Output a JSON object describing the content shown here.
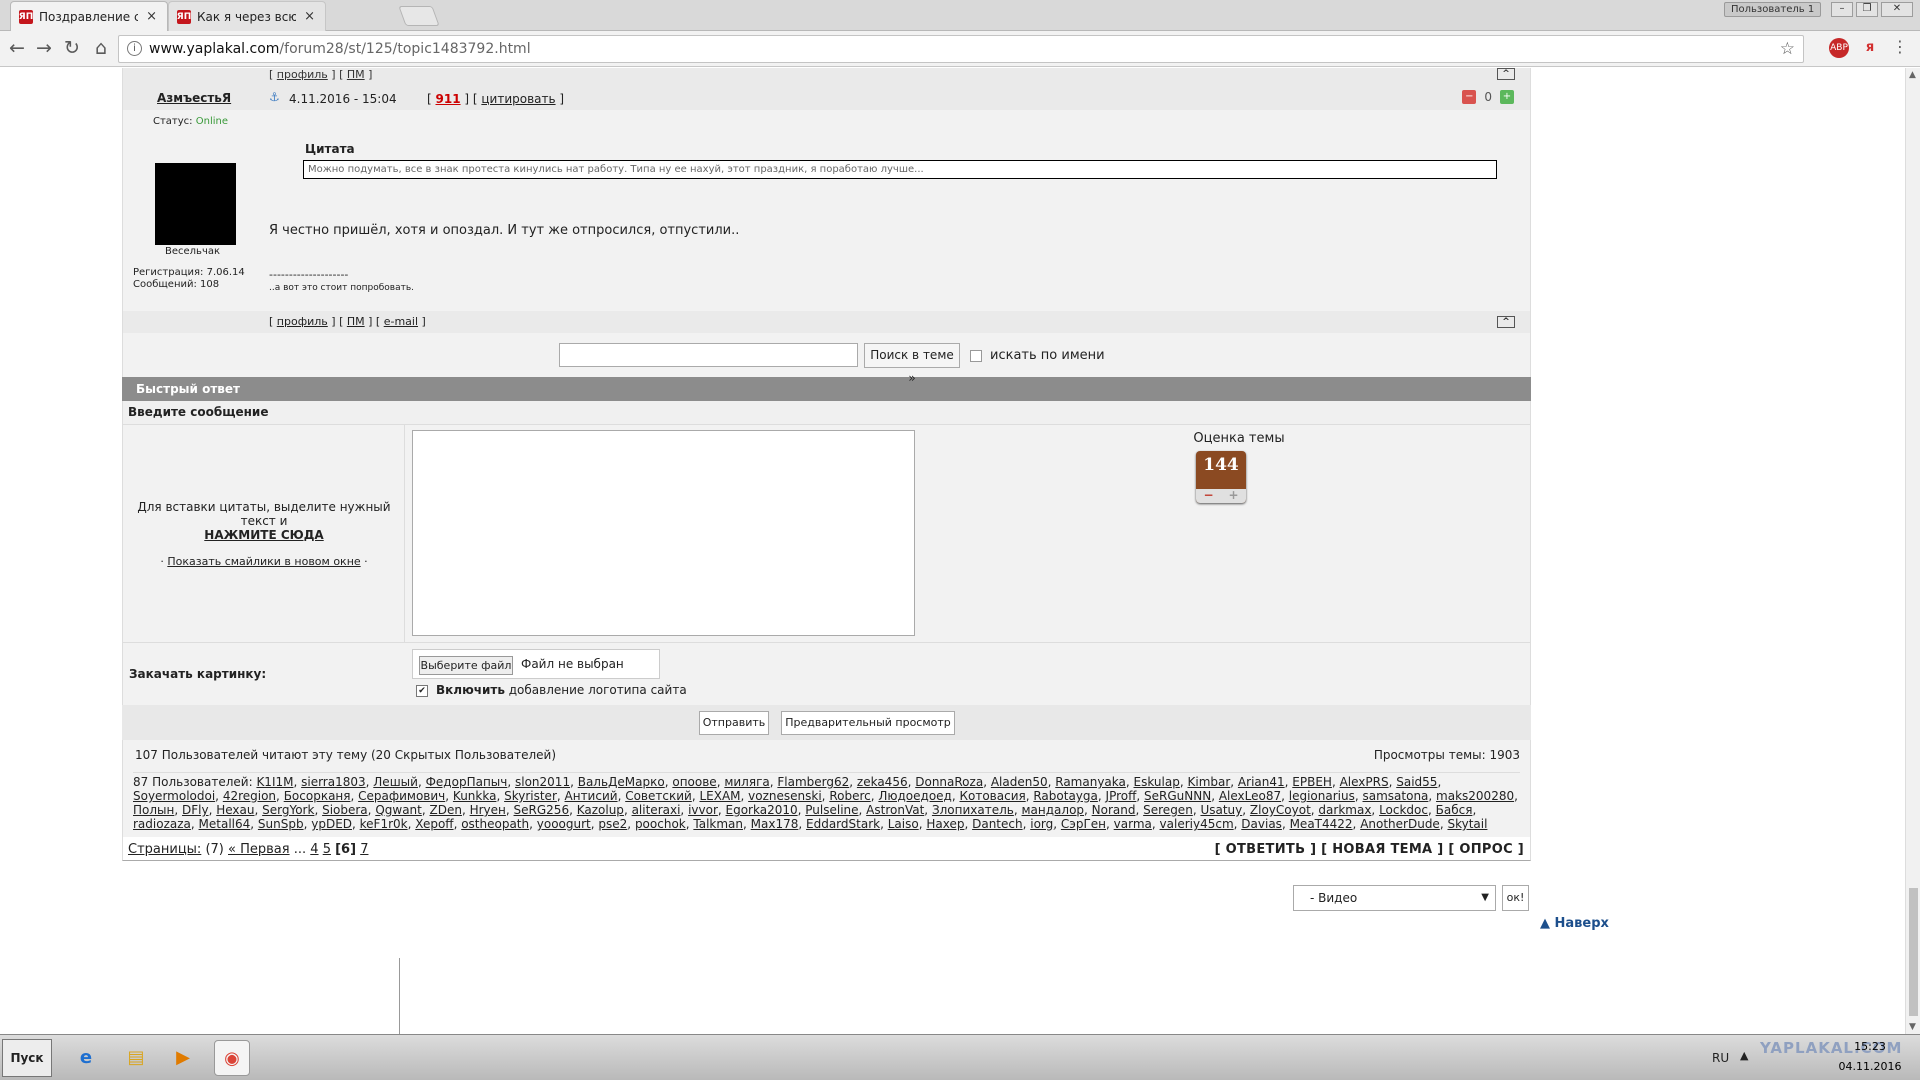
{
  "browser": {
    "tabs": [
      {
        "title": "Поздравление с Днем нар",
        "favicon": "ЯП",
        "active": true
      },
      {
        "title": "Как я через всю страну е",
        "favicon": "ЯП",
        "active": false
      }
    ],
    "profile_button": "Пользователь 1",
    "url_host": "www.yaplakal.com",
    "url_path": "/forum28/st/125/topic1483792.html"
  },
  "post": {
    "top_links": [
      "профиль",
      "ПМ"
    ],
    "author": "АзмъестьЯ",
    "date": "4.11.2016 - 15:04",
    "post_number": "911",
    "quote_link": "цитировать",
    "rep_count": "0",
    "status_label": "Статус:",
    "status_value": "Online",
    "rank": "Весельчак",
    "registration": "Регистрация: 7.06.14",
    "messages": "Сообщений: 108",
    "quote_label": "Цитата",
    "quote_text": "Можно подумать, все в знак протеста кинулись нат работу. Типа ну ее нахуй, этот праздник, я поработаю лучше...",
    "body": "Я честно пришёл, хотя и опоздал. И тут же отпросился, отпустили..",
    "signature_line": "--------------------",
    "signature": "..а вот это стоит попробовать.",
    "footer_links": [
      "профиль",
      "ПМ",
      "e-mail"
    ]
  },
  "search": {
    "button": "Поиск в теме »",
    "checkbox_label": "искать по имени"
  },
  "quick_reply": {
    "header": "Быстрый ответ",
    "message_label": "Введите сообщение",
    "hint": "Для вставки цитаты, выделите нужный текст и",
    "hint_link": "НАЖМИТЕ СЮДА",
    "smilies_link": "Показать смайлики в новом окне",
    "rating_label": "Оценка темы",
    "rating_value": "144",
    "upload_label": "Закачать картинку:",
    "file_button": "Выберите файл",
    "file_name": "Файл не выбран",
    "logo_bold": "Включить",
    "logo_rest": " добавление логотипа сайта",
    "send": "Отправить",
    "preview": "Предварительный просмотр"
  },
  "readers": {
    "summary": "107 Пользователей читают эту тему (20 Скрытых Пользователей)",
    "views": "Просмотры темы: 1903",
    "users_prefix": "87 Пользователей:",
    "users": [
      "K1I1M",
      "sierra1803",
      "Лешый",
      "ФедорПапыч",
      "slon2011",
      "ВальДеМарко",
      "опоовe",
      "миляга",
      "Flamberg62",
      "zeka456",
      "DonnaRoza",
      "Aladen50",
      "Ramanyaka",
      "Eskulap",
      "Kimbar",
      "Arian41",
      "EPBEH",
      "AlexPRS",
      "Said55",
      "Soyermolodoi",
      "42region",
      "Босорканя",
      "Серафимович",
      "Kunkka",
      "Skyrister",
      "Антисий",
      "Советский",
      "LEXAM",
      "voznesenski",
      "Roberc",
      "Людоедоед",
      "Котовасия",
      "Rabotayga",
      "JProff",
      "SeRGuNNN",
      "AlexLeo87",
      "legionarius",
      "samsatona",
      "maks200280",
      "Полын",
      "DFly",
      "Hexau",
      "SergYork",
      "Siobera",
      "Qgwant",
      "ZDen",
      "Hryeн",
      "SeRG256",
      "Kazolup",
      "aliteraxi",
      "ivvor",
      "Egorka2010",
      "Pulseline",
      "AstronVat",
      "Злопихатель",
      "мандалор",
      "Norand",
      "Seregen",
      "Usatuy",
      "ZloyCoyot",
      "darkmax",
      "Lockdoc",
      "Бабся",
      "radiozaza",
      "Metall64",
      "SunSpb",
      "ypDED",
      "keF1r0k",
      "Xepoff",
      "ostheopath",
      "yooogurt",
      "pse2",
      "poochok",
      "Talkman",
      "Max178",
      "EddardStark",
      "Laiso",
      "Haxep",
      "Dantech",
      "iorg",
      "СэрГен",
      "varma",
      "valeriy45cm",
      "Davias",
      "MeaT4422",
      "AnotherDude",
      "Skytail"
    ],
    "pages_label": "Страницы:",
    "pages_count": "(7)",
    "first": "« Первая",
    "ellipsis": "...",
    "page_links": [
      "4",
      "5"
    ],
    "current_page": "[6]",
    "last_page": "7",
    "actions": "[ ОТВЕТИТЬ ] [ НОВАЯ ТЕМА ] [ ОПРОС ]"
  },
  "jump": {
    "selected": "- Видео",
    "ok": "ок!",
    "to_top": "Наверх"
  },
  "taskbar": {
    "start": "Пуск",
    "lang": "RU",
    "watermark": "YAPLAKAL.COM",
    "time": "15:23",
    "date": "04.11.2016"
  },
  "colors": {
    "online": "#3a9a3a",
    "post_number": "#cc0000",
    "header_bar": "#8c8c8c",
    "to_top": "#1d4f8c"
  }
}
